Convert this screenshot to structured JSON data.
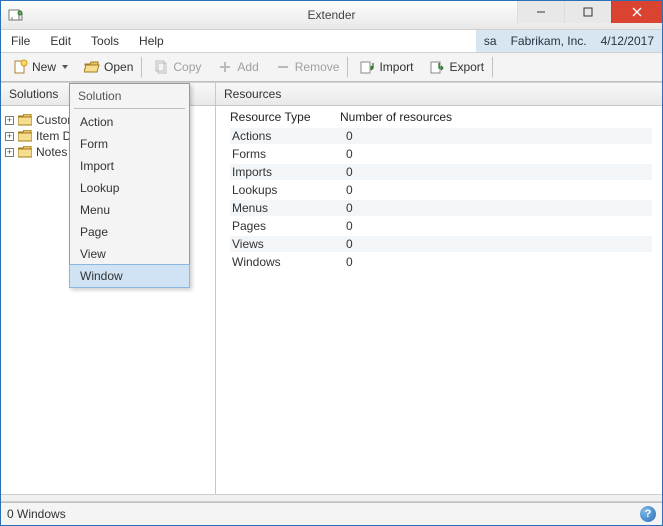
{
  "titlebar": {
    "title": "Extender"
  },
  "menubar": {
    "items": [
      "File",
      "Edit",
      "Tools",
      "Help"
    ],
    "user": "sa",
    "company": "Fabrikam, Inc.",
    "date": "4/12/2017"
  },
  "toolbar": {
    "new_label": "New",
    "open_label": "Open",
    "copy_label": "Copy",
    "add_label": "Add",
    "remove_label": "Remove",
    "import_label": "Import",
    "export_label": "Export"
  },
  "dropdown": {
    "header": "Solution",
    "items": [
      "Action",
      "Form",
      "Import",
      "Lookup",
      "Menu",
      "Page",
      "View",
      "Window"
    ],
    "highlight_index": 7
  },
  "left_pane": {
    "header": "Solutions",
    "tree": [
      "Customers",
      "Item Details",
      "Notes"
    ],
    "tree_visible": [
      "Custom",
      "Item D",
      "Notes"
    ]
  },
  "right_pane": {
    "header": "Resources",
    "columns": [
      "Resource Type",
      "Number of resources"
    ],
    "rows": [
      {
        "type": "Actions",
        "count": "0"
      },
      {
        "type": "Forms",
        "count": "0"
      },
      {
        "type": "Imports",
        "count": "0"
      },
      {
        "type": "Lookups",
        "count": "0"
      },
      {
        "type": "Menus",
        "count": "0"
      },
      {
        "type": "Pages",
        "count": "0"
      },
      {
        "type": "Views",
        "count": "0"
      },
      {
        "type": "Windows",
        "count": "0"
      }
    ]
  },
  "statusbar": {
    "text": "0 Windows"
  }
}
